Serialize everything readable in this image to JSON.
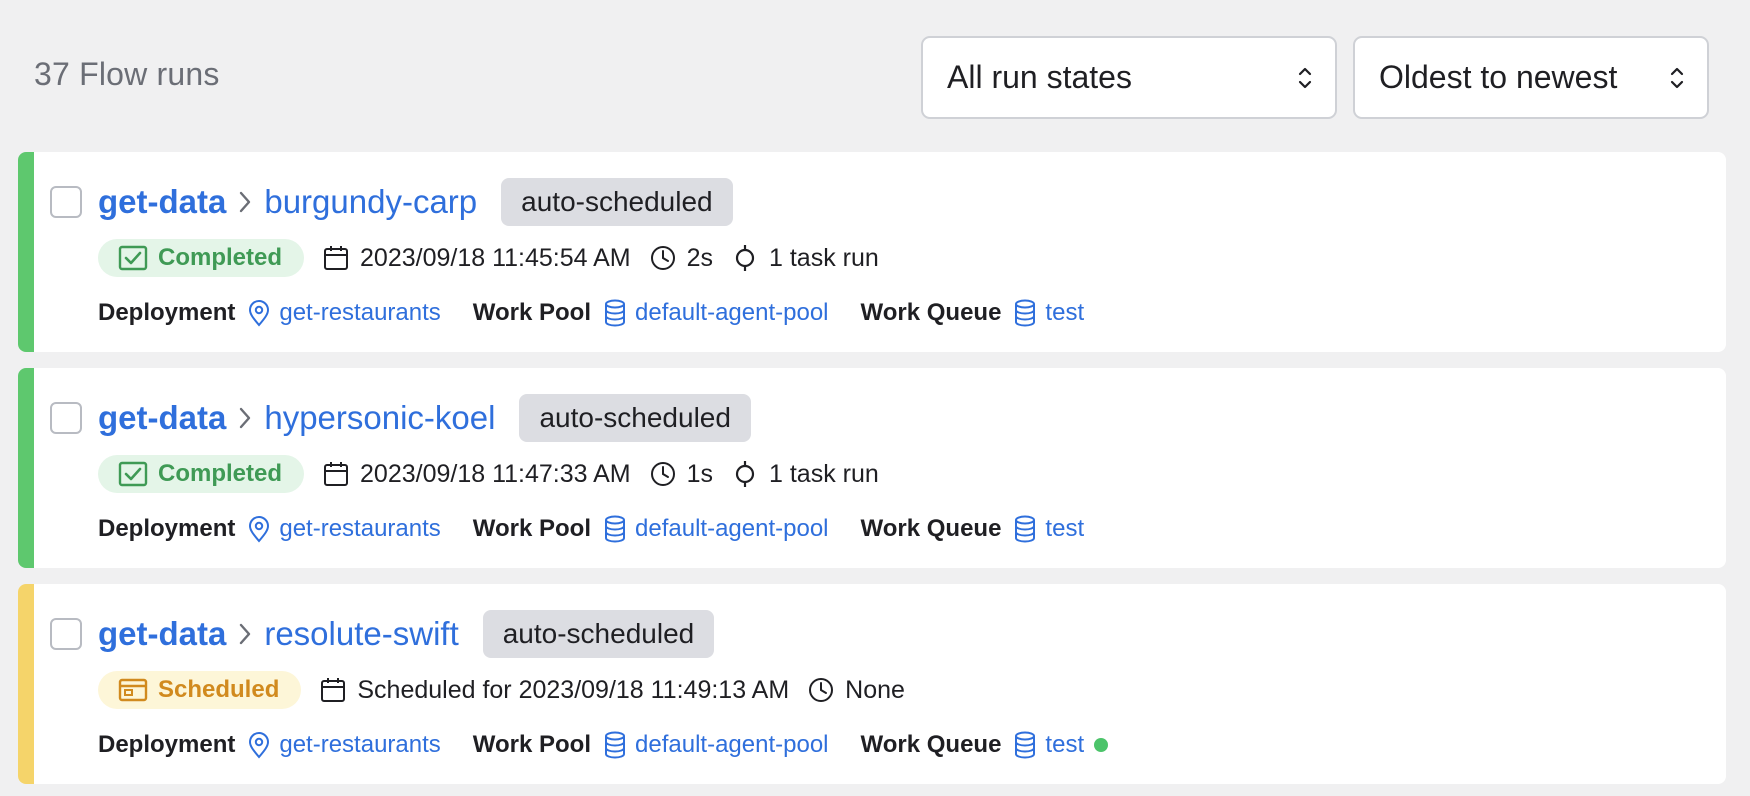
{
  "header": {
    "count_label": "37 Flow runs",
    "state_filter": "All run states",
    "sort_order": "Oldest to newest"
  },
  "colors": {
    "completed": "#5ec86e",
    "scheduled": "#f5d46a",
    "link": "#2f6fdc"
  },
  "runs": [
    {
      "flow": "get-data",
      "run": "burgundy-carp",
      "tag": "auto-scheduled",
      "state": "Completed",
      "datetime": "2023/09/18 11:45:54 AM",
      "duration": "2s",
      "task_runs": "1 task run",
      "deployment_label": "Deployment",
      "deployment": "get-restaurants",
      "work_pool_label": "Work Pool",
      "work_pool": "default-agent-pool",
      "work_queue_label": "Work Queue",
      "work_queue": "test"
    },
    {
      "flow": "get-data",
      "run": "hypersonic-koel",
      "tag": "auto-scheduled",
      "state": "Completed",
      "datetime": "2023/09/18 11:47:33 AM",
      "duration": "1s",
      "task_runs": "1 task run",
      "deployment_label": "Deployment",
      "deployment": "get-restaurants",
      "work_pool_label": "Work Pool",
      "work_pool": "default-agent-pool",
      "work_queue_label": "Work Queue",
      "work_queue": "test"
    },
    {
      "flow": "get-data",
      "run": "resolute-swift",
      "tag": "auto-scheduled",
      "state": "Scheduled",
      "datetime": "Scheduled for 2023/09/18 11:49:13 AM",
      "duration": "None",
      "deployment_label": "Deployment",
      "deployment": "get-restaurants",
      "work_pool_label": "Work Pool",
      "work_pool": "default-agent-pool",
      "work_queue_label": "Work Queue",
      "work_queue": "test"
    }
  ]
}
